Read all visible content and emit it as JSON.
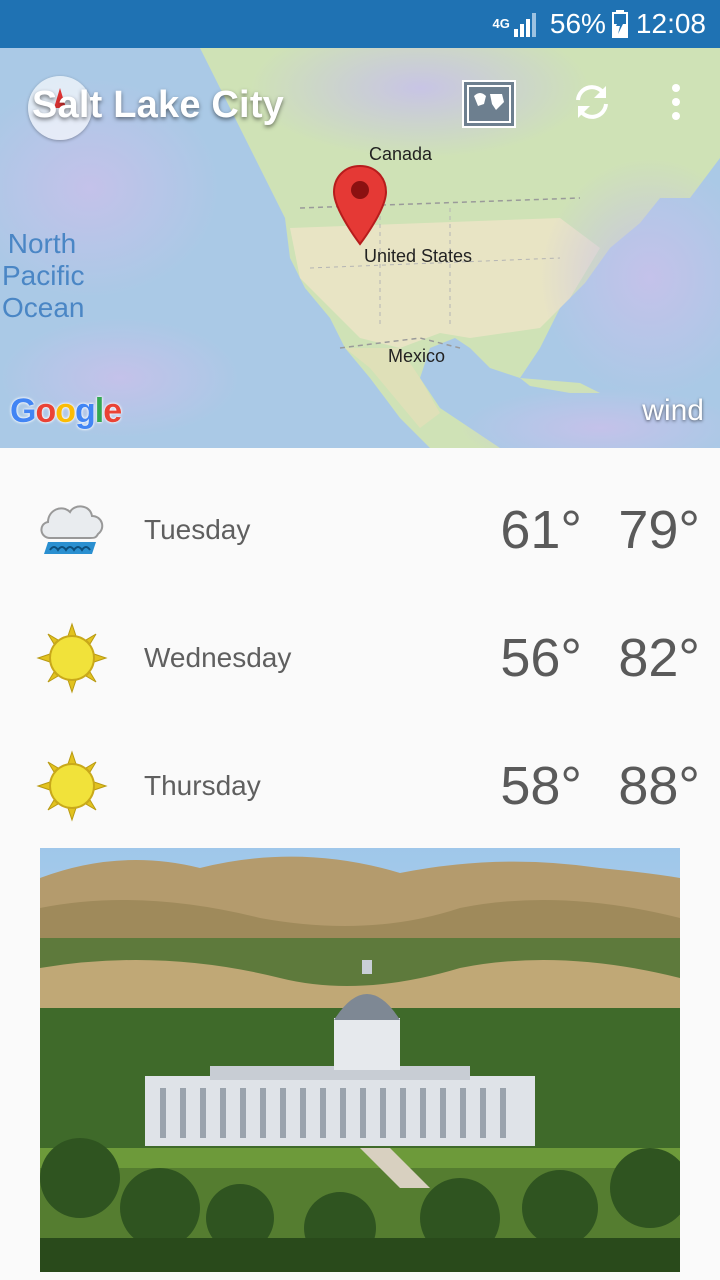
{
  "status_bar": {
    "network": "4G",
    "battery": "56%",
    "time": "12:08"
  },
  "map": {
    "city": "Salt Lake City",
    "labels": {
      "canada": "Canada",
      "united_states": "United States",
      "mexico": "Mexico",
      "ocean": "North Pacific Ocean"
    },
    "attribution": "Google",
    "layer": "wind"
  },
  "forecast": [
    {
      "day": "Tuesday",
      "low": "61°",
      "high": "79°",
      "icon": "rain-cloud-icon"
    },
    {
      "day": "Wednesday",
      "low": "56°",
      "high": "82°",
      "icon": "sun-icon"
    },
    {
      "day": "Thursday",
      "low": "58°",
      "high": "88°",
      "icon": "sun-icon"
    }
  ],
  "colors": {
    "status_bar": "#1f72b3",
    "text_gray": "#5a5a5a",
    "sun": "#f1e23a",
    "pin": "#e53935"
  }
}
